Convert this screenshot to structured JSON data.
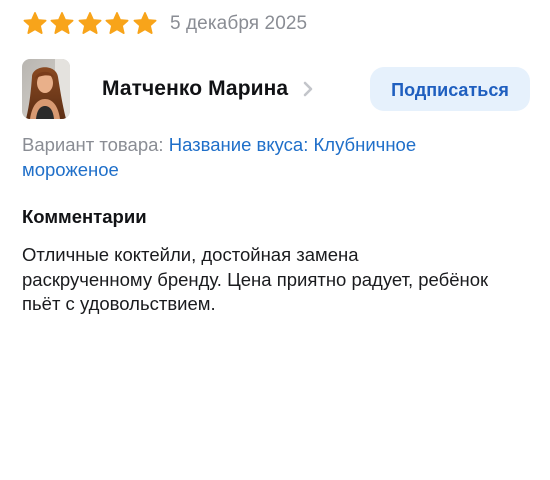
{
  "review": {
    "rating": 5,
    "rating_max": 5,
    "star_color": "#f8a41a",
    "date": "5 декабря 2025"
  },
  "author": {
    "name": "Матченко Марина",
    "avatar_icon": "user-photo",
    "chevron_icon": "chevron-right-icon"
  },
  "subscribe": {
    "label": "Подписаться",
    "bg_color": "#e6f1fc",
    "text_color": "#1f5fbf"
  },
  "variant": {
    "label": "Вариант товара: ",
    "value": "Название вкуса: Клубничное мороженое",
    "value_color": "#1f6fc9"
  },
  "comments": {
    "heading": "Комментарии",
    "text": "Отличные коктейли, достойная замена раскрученному бренду. Цена приятно радует, ребёнок пьёт с удовольствием."
  }
}
